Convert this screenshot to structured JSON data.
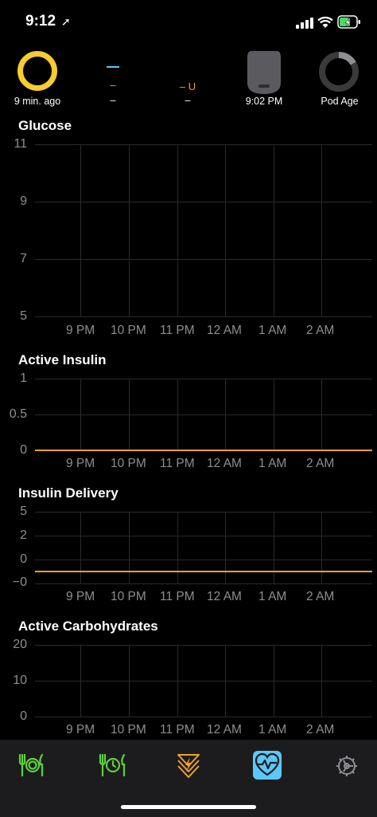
{
  "status_bar": {
    "time": "9:12",
    "location_glyph": "➚"
  },
  "hud": {
    "glucose_age": "9 min. ago",
    "blue_value": "–",
    "blue_sub": "–",
    "insulin_value": "– U",
    "insulin_sub": "–",
    "pod_time": "9:02 PM",
    "pod_age_label": "Pod Age"
  },
  "charts": {
    "glucose": {
      "title": "Glucose",
      "y_ticks": [
        "11",
        "9",
        "7",
        "5"
      ]
    },
    "active_insulin": {
      "title": "Active Insulin",
      "y_ticks": [
        "1",
        "0.5",
        "0"
      ]
    },
    "insulin_delivery": {
      "title": "Insulin Delivery",
      "y_ticks": [
        "5",
        "2",
        "0",
        "−0"
      ]
    },
    "active_carbs": {
      "title": "Active Carbohydrates",
      "y_ticks": [
        "20",
        "10",
        "0"
      ]
    },
    "x_ticks": [
      "9 PM",
      "10 PM",
      "11 PM",
      "12 AM",
      "1 AM",
      "2 AM"
    ]
  },
  "tabs": {
    "carb_entry": "carb-entry-icon",
    "bolus": "bolus-icon",
    "override": "override-icon",
    "health": "health-icon",
    "settings": "settings-icon"
  },
  "colors": {
    "accent_orange": "#f0a030",
    "green": "#5dd13b",
    "blue": "#5ac8fa",
    "yellow": "#f7cc2e"
  }
}
